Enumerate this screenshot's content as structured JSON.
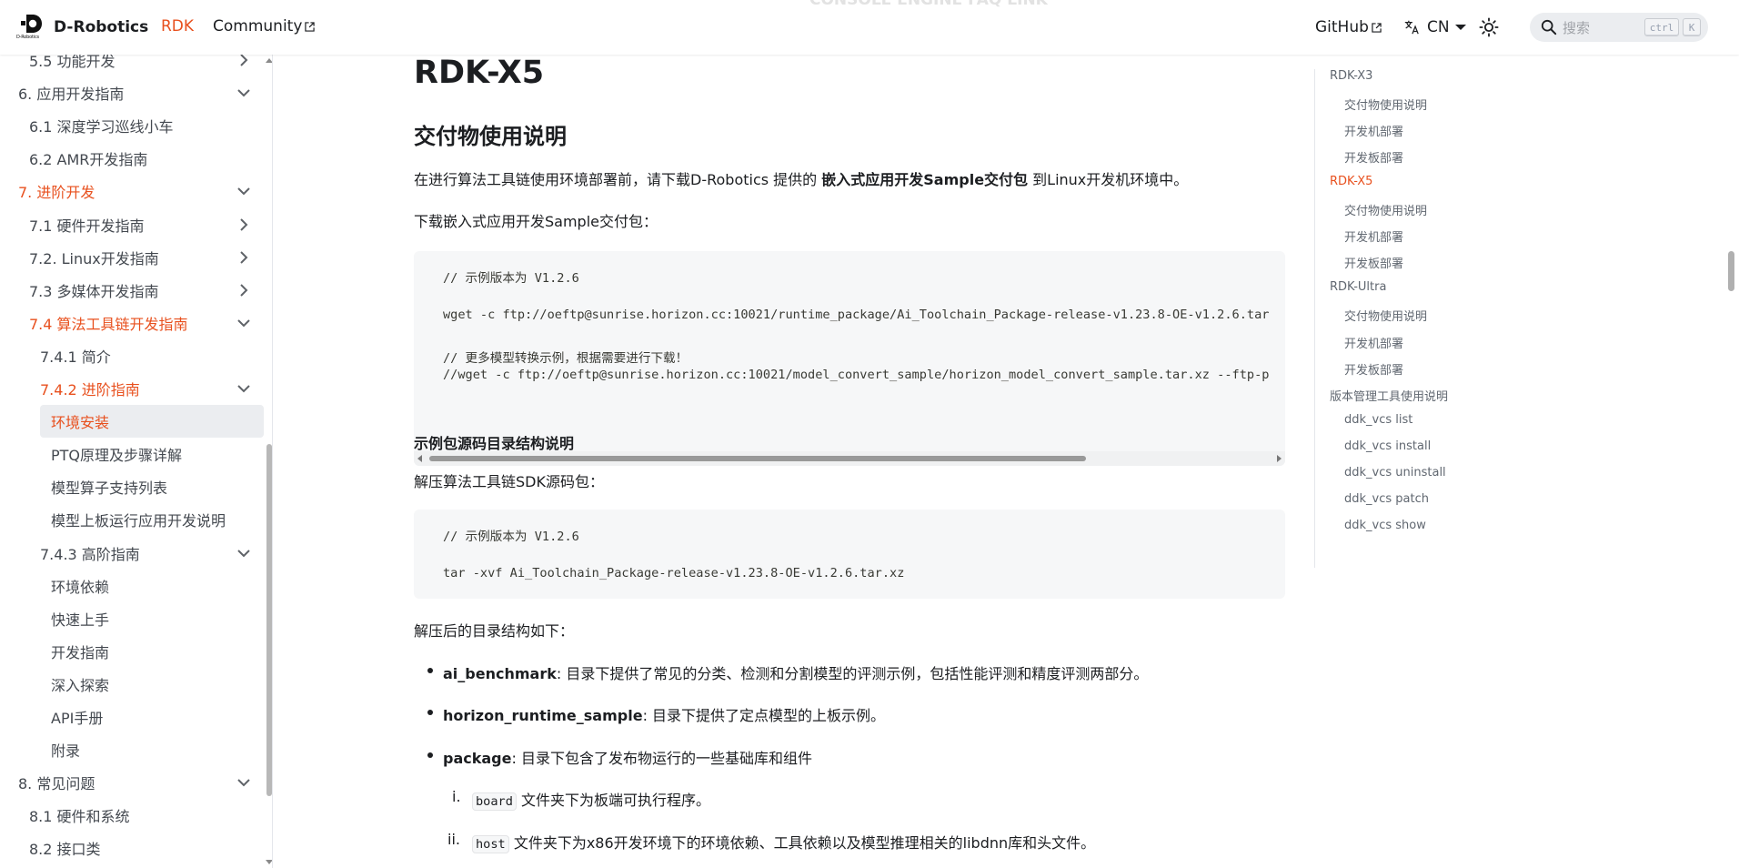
{
  "navbar": {
    "brand_title": "D-Robotics",
    "brand_logo_text": "D-Robotics",
    "links": [
      "RDK",
      "Community"
    ],
    "github": "GitHub",
    "lang": "CN",
    "search_placeholder": "搜索",
    "kbd_ctrl": "ctrl",
    "kbd_k": "K",
    "ghost_text": "CONSOLE ENGINE FAQ LINK"
  },
  "sidebar": {
    "items": [
      {
        "label": "5.5 功能开发",
        "chevron": "right"
      },
      {
        "label": "6. 应用开发指南",
        "chevron": "down"
      },
      {
        "label": "6.1 深度学习巡线小车",
        "chevron": ""
      },
      {
        "label": "6.2 AMR开发指南",
        "chevron": ""
      },
      {
        "label": "7. 进阶开发",
        "chevron": "down",
        "active": true
      },
      {
        "label": "7.1 硬件开发指南",
        "chevron": "right"
      },
      {
        "label": "7.2. Linux开发指南",
        "chevron": "right"
      },
      {
        "label": "7.3 多媒体开发指南",
        "chevron": "right"
      },
      {
        "label": "7.4 算法工具链开发指南",
        "chevron": "down",
        "active": true
      },
      {
        "label": "7.4.1 简介",
        "chevron": ""
      },
      {
        "label": "7.4.2 进阶指南",
        "chevron": "down",
        "active": true
      },
      {
        "label": "环境安装",
        "chevron": "",
        "active": true,
        "selected": true
      },
      {
        "label": "PTQ原理及步骤详解",
        "chevron": ""
      },
      {
        "label": "模型算子支持列表",
        "chevron": ""
      },
      {
        "label": "模型上板运行应用开发说明",
        "chevron": ""
      },
      {
        "label": "7.4.3 高阶指南",
        "chevron": "down"
      },
      {
        "label": "环境依赖",
        "chevron": ""
      },
      {
        "label": "快速上手",
        "chevron": ""
      },
      {
        "label": "开发指南",
        "chevron": ""
      },
      {
        "label": "深入探索",
        "chevron": ""
      },
      {
        "label": "API手册",
        "chevron": ""
      },
      {
        "label": "附录",
        "chevron": ""
      },
      {
        "label": "8. 常见问题",
        "chevron": "down"
      },
      {
        "label": "8.1 硬件和系统",
        "chevron": ""
      },
      {
        "label": "8.2 接口类",
        "chevron": ""
      }
    ]
  },
  "main": {
    "h1": "RDK-X5",
    "h2": "交付物使用说明",
    "p1_pre": "在进行算法工具链使用环境部署前，请下载D-Robotics 提供的 ",
    "p1_bold": "嵌入式应用开发Sample交付包",
    "p1_post": " 到Linux开发机环境中。",
    "p2": "下载嵌入式应用开发Sample交付包：",
    "code1": [
      "// 示例版本为 V1.2.6",
      "wget -c ftp://oeftp@sunrise.horizon.cc:10021/runtime_package/Ai_Toolchain_Package-release-v1.23.8-OE-v1.2.6.tar",
      "// 更多模型转换示例，根据需要进行下载！",
      "//wget -c ftp://oeftp@sunrise.horizon.cc:10021/model_convert_sample/horizon_model_convert_sample.tar.xz --ftp-p"
    ],
    "h3": "示例包源码目录结构说明",
    "p3": "解压算法工具链SDK源码包：",
    "code2": [
      "// 示例版本为 V1.2.6",
      "tar -xvf Ai_Toolchain_Package-release-v1.23.8-OE-v1.2.6.tar.xz"
    ],
    "p4": "解压后的目录结构如下：",
    "bullets": [
      {
        "term": "ai_benchmark",
        "desc": ": 目录下提供了常见的分类、检测和分割模型的评测示例，包括性能评测和精度评测两部分。"
      },
      {
        "term": "horizon_runtime_sample",
        "desc": ": 目录下提供了定点模型的上板示例。"
      },
      {
        "term": "package",
        "desc": ": 目录下包含了发布物运行的一些基础库和组件"
      }
    ],
    "sub_items": [
      {
        "num": "i.",
        "code": "board",
        "desc": " 文件夹下为板端可执行程序。"
      },
      {
        "num": "ii.",
        "code": "host",
        "desc": " 文件夹下为x86开发环境下的环境依赖、工具依赖以及模型推理相关的libdnn库和头文件。"
      }
    ]
  },
  "toc": {
    "items": [
      {
        "label": "RDK-X3",
        "level": 1
      },
      {
        "label": "交付物使用说明",
        "level": 2
      },
      {
        "label": "开发机部署",
        "level": 2
      },
      {
        "label": "开发板部署",
        "level": 2
      },
      {
        "label": "RDK-X5",
        "level": 1,
        "active": true
      },
      {
        "label": "交付物使用说明",
        "level": 2
      },
      {
        "label": "开发机部署",
        "level": 2
      },
      {
        "label": "开发板部署",
        "level": 2
      },
      {
        "label": "RDK-Ultra",
        "level": 1
      },
      {
        "label": "交付物使用说明",
        "level": 2
      },
      {
        "label": "开发机部署",
        "level": 2
      },
      {
        "label": "开发板部署",
        "level": 2
      },
      {
        "label": "版本管理工具使用说明",
        "level": 1
      },
      {
        "label": "ddk_vcs list",
        "level": 2
      },
      {
        "label": "ddk_vcs install",
        "level": 2
      },
      {
        "label": "ddk_vcs uninstall",
        "level": 2
      },
      {
        "label": "ddk_vcs patch",
        "level": 2
      },
      {
        "label": "ddk_vcs show",
        "level": 2
      }
    ]
  },
  "colors": {
    "accent": "#e8501e",
    "text": "#1c1e21",
    "code_bg": "#f6f7f8"
  }
}
